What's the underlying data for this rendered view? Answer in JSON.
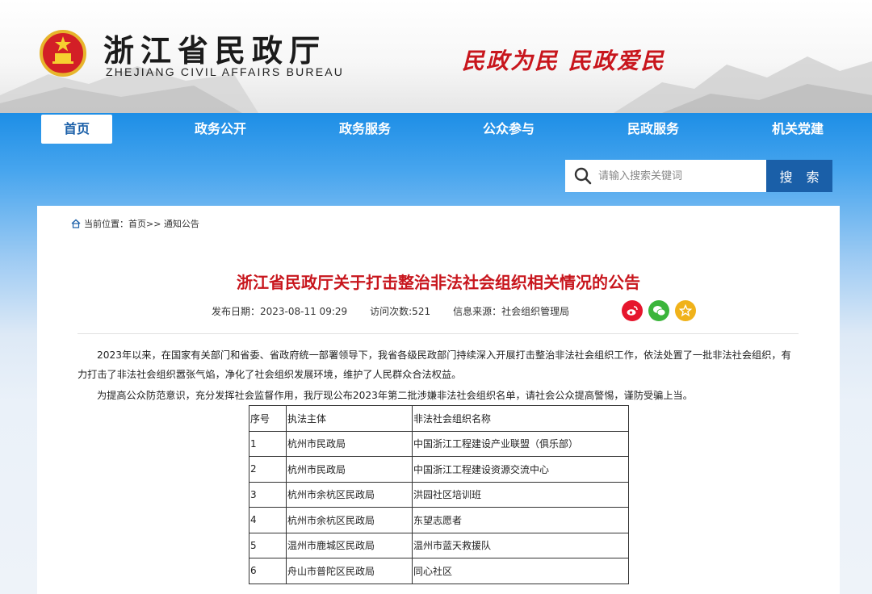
{
  "header": {
    "title": "浙江省民政厅",
    "subtitle": "ZHEJIANG CIVIL AFFAIRS BUREAU",
    "slogan": "民政为民  民政爱民",
    "emblem_icon": "national-emblem-icon"
  },
  "nav": {
    "items": [
      {
        "label": "首页",
        "active": true
      },
      {
        "label": "政务公开"
      },
      {
        "label": "政务服务"
      },
      {
        "label": "公众参与"
      },
      {
        "label": "民政服务"
      },
      {
        "label": "机关党建"
      }
    ]
  },
  "search": {
    "placeholder": "请输入搜索关键词",
    "value": "",
    "button_label": "搜 索",
    "icon": "search-icon"
  },
  "breadcrumb": {
    "icon": "home-icon",
    "text": "当前位置：首页>> 通知公告"
  },
  "article": {
    "title": "浙江省民政厅关于打击整治非法社会组织相关情况的公告",
    "publish_date": "发布日期：2023-08-11 09:29",
    "visits": "访问次数:521",
    "source": "信息来源：社会组织管理局",
    "share_icons": [
      "weibo-icon",
      "wechat-icon",
      "favorite-icon"
    ],
    "paragraphs": [
      "2023年以来，在国家有关部门和省委、省政府统一部署领导下，我省各级民政部门持续深入开展打击整治非法社会组织工作，依法处置了一批非法社会组织，有力打击了非法社会组织嚣张气焰，净化了社会组织发展环境，维护了人民群众合法权益。",
      "为提高公众防范意识，充分发挥社会监督作用，我厅现公布2023年第二批涉嫌非法社会组织名单，请社会公众提高警惕，谨防受骗上当。"
    ]
  },
  "table": {
    "headers": [
      "序号",
      "执法主体",
      "非法社会组织名称"
    ],
    "rows": [
      [
        "1",
        "杭州市民政局",
        "中国浙江工程建设产业联盟（俱乐部）"
      ],
      [
        "2",
        "杭州市民政局",
        "中国浙江工程建设资源交流中心"
      ],
      [
        "3",
        "杭州市余杭区民政局",
        "洪园社区培训班"
      ],
      [
        "4",
        "杭州市余杭区民政局",
        "东望志愿者"
      ],
      [
        "5",
        "温州市鹿城区民政局",
        "温州市蓝天救援队"
      ],
      [
        "6",
        "舟山市普陀区民政局",
        "同心社区"
      ]
    ]
  },
  "colors": {
    "nav_blue": "#1d8ee6",
    "title_red": "#c8161d",
    "search_button": "#1a5fa8"
  }
}
